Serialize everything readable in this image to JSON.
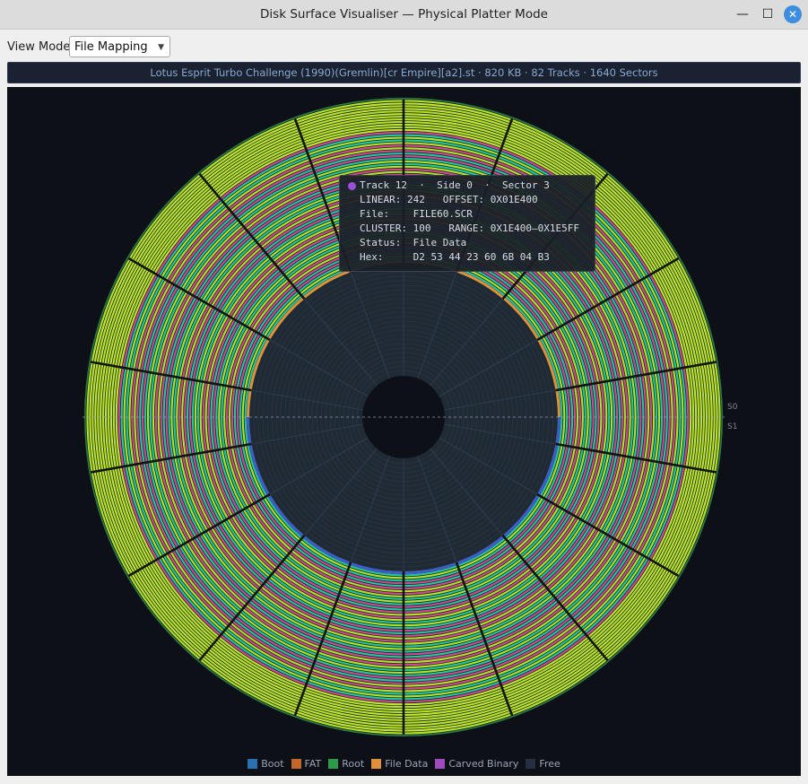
{
  "window": {
    "title": "Disk Surface Visualiser  —  Physical Platter Mode",
    "minimize_glyph": "—",
    "maximize_glyph": "☐",
    "close_glyph": "✕"
  },
  "toolbar": {
    "view_mode_label": "View Mode:",
    "view_mode_value": "File Mapping"
  },
  "info": {
    "text": "Lotus Esprit Turbo Challenge (1990)(Gremlin)[cr Empire][a2].st  ·  820 KB  ·  82 Tracks  ·  1640 Sectors"
  },
  "tooltip": {
    "dot_color": "#9b4fd6",
    "header": "Track 12  ·  Side 0  ·  Sector 3",
    "linear": "LINEAR: 242   OFFSET: 0X01E400",
    "file": "File:    FILE60.SCR",
    "cluster": "CLUSTER: 100   RANGE: 0X1E400–0X1E5FF",
    "status": "Status:  File Data",
    "hex": "Hex:     D2 53 44 23 60 6B 04 B3"
  },
  "platter": {
    "side_top": "S0",
    "side_bottom": "S1",
    "track_count": 82
  },
  "legend": [
    {
      "label": "Boot",
      "color": "#2a6fb0"
    },
    {
      "label": "FAT",
      "color": "#c0682a"
    },
    {
      "label": "Root",
      "color": "#2d9a4a"
    },
    {
      "label": "File Data",
      "color": "#e0903a"
    },
    {
      "label": "Carved Binary",
      "color": "#a04ac0"
    },
    {
      "label": "Free",
      "color": "#243040"
    }
  ],
  "palette": [
    "#b5e02e",
    "#d0e23a",
    "#3ec24a",
    "#27c4a8",
    "#3a6fdc",
    "#a848d8",
    "#d2479a",
    "#e23a5a",
    "#6ed43a"
  ]
}
